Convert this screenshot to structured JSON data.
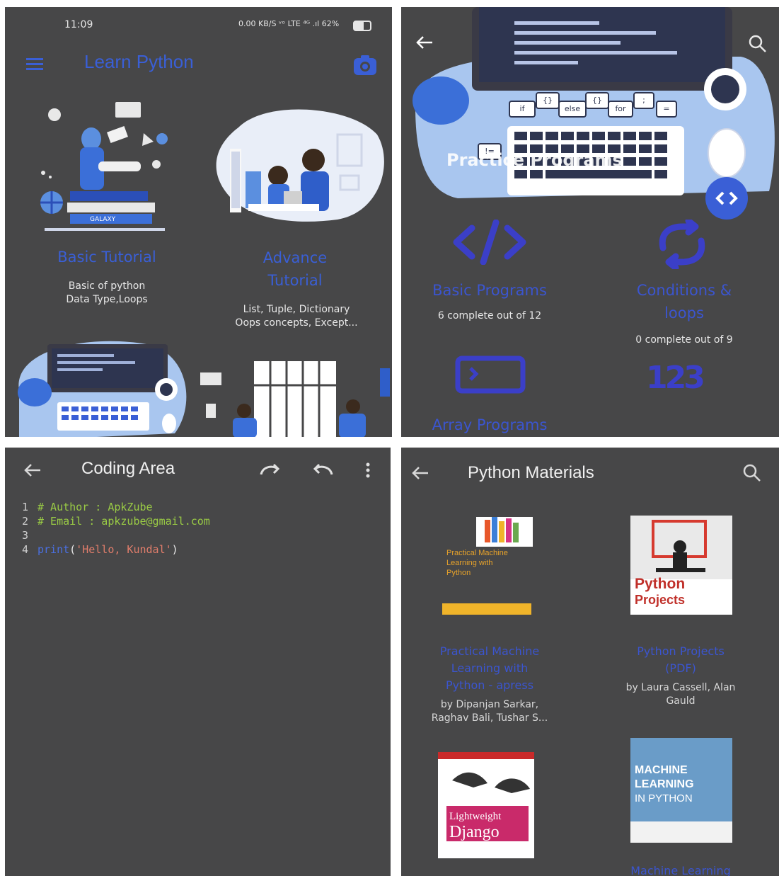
{
  "home": {
    "time": "11:09",
    "status_icons": "0.00 KB/S  ᵛᵒ LTE  ⁴ᴳ .ıl  62%",
    "title": "Learn Python",
    "cards": [
      {
        "title": "Basic Tutorial",
        "sub1": "Basic of python",
        "sub2": "Data Type,Loops",
        "illustration_text": "GALAXY"
      },
      {
        "title1": "Advance",
        "title2": "Tutorial",
        "sub1": "List, Tuple, Dictionary",
        "sub2": "Oops concepts, Except..."
      }
    ]
  },
  "programs": {
    "banner_text": "Practice Programs",
    "code_bubbles": [
      "if",
      "{}",
      "else",
      "{}",
      "for",
      ";",
      "=",
      "!="
    ],
    "items": [
      {
        "title": "Basic Programs",
        "sub": "6 complete out of 12"
      },
      {
        "title1": "Conditions &",
        "title2": "loops",
        "sub": "0 complete out of 9"
      },
      {
        "title": "Array Programs"
      }
    ],
    "numbers_glyph": "123"
  },
  "coding": {
    "title": "Coding Area",
    "lines": [
      {
        "n": "1",
        "text": "# Author : ApkZube"
      },
      {
        "n": "2",
        "text": "# Email : apkzube@gmail.com"
      },
      {
        "n": "3",
        "text": ""
      },
      {
        "n": "4",
        "fn": "print",
        "open": "(",
        "str": "'Hello, Kundal'",
        "close": ")"
      }
    ]
  },
  "materials": {
    "title": "Python Materials",
    "books": [
      {
        "title1": "Practical Machine",
        "title2": "Learning with",
        "title3": "Python - apress",
        "author1": "by Dipanjan Sarkar,",
        "author2": "Raghav Bali, Tushar S...",
        "cover_text1": "Practical Machine",
        "cover_text2": "Learning with",
        "cover_text3": "Python"
      },
      {
        "title1": "Python Projects",
        "title2": "(PDF)",
        "author1": "by Laura Cassell, Alan",
        "author2": "Gauld",
        "cover_text1": "Python",
        "cover_text2": "Projects"
      },
      {
        "cover_text1": "Lightweight",
        "cover_text2": "Django"
      },
      {
        "cover_text1": "MACHINE",
        "cover_text2": "LEARNING",
        "cover_text3": "IN PYTHON",
        "title1": "Machine Learning"
      }
    ]
  },
  "colors": {
    "panel_bg": "#474748",
    "accent": "#3a5fd6",
    "illustration_blue": "#5b8fdf",
    "light_blue": "#a9c6ef"
  }
}
